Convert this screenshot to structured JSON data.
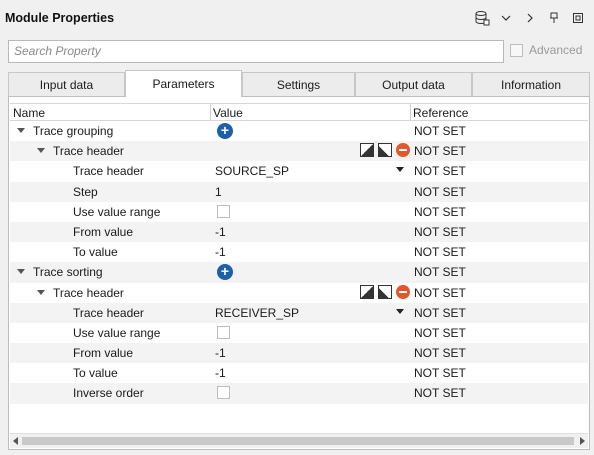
{
  "window": {
    "title": "Module Properties",
    "icons": [
      "database-icon",
      "chevron-down-icon",
      "chevron-right-icon",
      "pin-icon",
      "restore-icon"
    ]
  },
  "search": {
    "placeholder": "Search Property"
  },
  "advanced": {
    "label": "Advanced",
    "checked": false
  },
  "tabs": [
    {
      "label": "Input data",
      "active": false
    },
    {
      "label": "Parameters",
      "active": true
    },
    {
      "label": "Settings",
      "active": false
    },
    {
      "label": "Output data",
      "active": false
    },
    {
      "label": "Information",
      "active": false
    }
  ],
  "table": {
    "columns": {
      "name": "Name",
      "value": "Value",
      "reference": "Reference"
    },
    "rows": [
      {
        "name": "Trace grouping",
        "level": 0,
        "expander": true,
        "value": "",
        "control": "add",
        "reference": "NOT SET"
      },
      {
        "name": "Trace header",
        "level": 1,
        "expander": true,
        "value": "",
        "control": "item-actions",
        "reference": "NOT SET"
      },
      {
        "name": "Trace header",
        "level": 2,
        "expander": false,
        "value": "SOURCE_SP",
        "control": "dropdown",
        "reference": "NOT SET"
      },
      {
        "name": "Step",
        "level": 2,
        "expander": false,
        "value": "1",
        "control": "text",
        "reference": "NOT SET"
      },
      {
        "name": "Use value range",
        "level": 2,
        "expander": false,
        "value": "",
        "control": "checkbox",
        "reference": "NOT SET"
      },
      {
        "name": "From value",
        "level": 2,
        "expander": false,
        "value": "-1",
        "control": "text",
        "reference": "NOT SET"
      },
      {
        "name": "To value",
        "level": 2,
        "expander": false,
        "value": "-1",
        "control": "text",
        "reference": "NOT SET"
      },
      {
        "name": "Trace sorting",
        "level": 0,
        "expander": true,
        "value": "",
        "control": "add",
        "reference": "NOT SET"
      },
      {
        "name": "Trace header",
        "level": 1,
        "expander": true,
        "value": "",
        "control": "item-actions",
        "reference": "NOT SET"
      },
      {
        "name": "Trace header",
        "level": 2,
        "expander": false,
        "value": "RECEIVER_SP",
        "control": "dropdown",
        "reference": "NOT SET"
      },
      {
        "name": "Use value range",
        "level": 2,
        "expander": false,
        "value": "",
        "control": "checkbox",
        "reference": "NOT SET"
      },
      {
        "name": "From value",
        "level": 2,
        "expander": false,
        "value": "-1",
        "control": "text",
        "reference": "NOT SET"
      },
      {
        "name": "To value",
        "level": 2,
        "expander": false,
        "value": "-1",
        "control": "text",
        "reference": "NOT SET"
      },
      {
        "name": "Inverse order",
        "level": 2,
        "expander": false,
        "value": "",
        "control": "checkbox",
        "reference": "NOT SET"
      }
    ]
  },
  "colors": {
    "accent": "#1e5fa8",
    "remove": "#e2572b",
    "row_alt": "#f3f3f3"
  }
}
